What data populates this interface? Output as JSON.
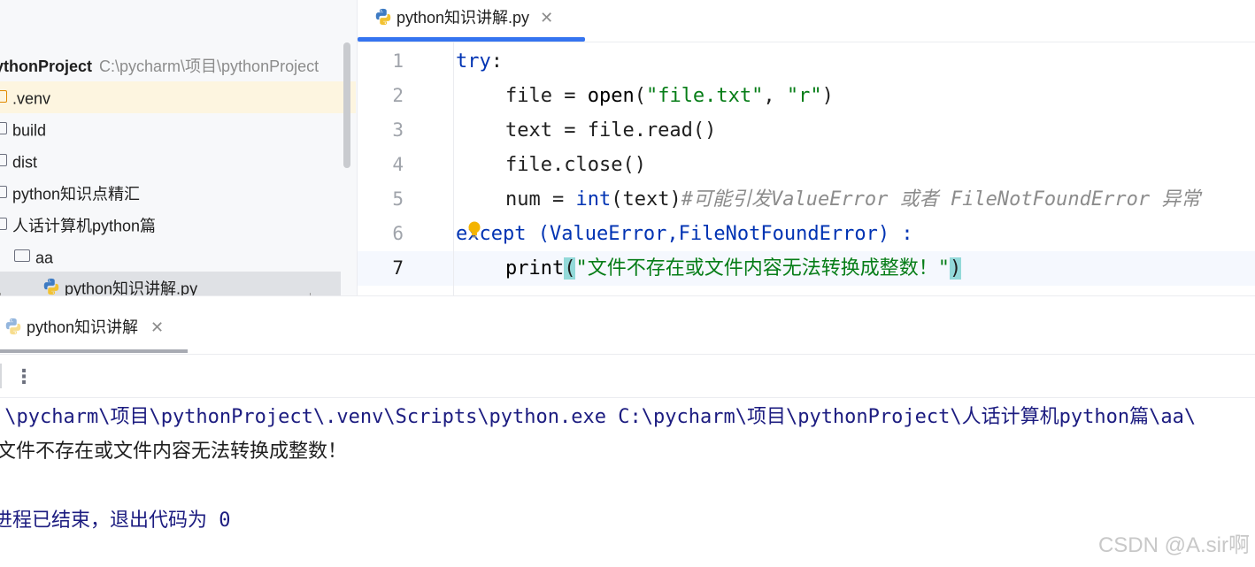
{
  "project": {
    "root_name": "ythonProject",
    "root_path": "C:\\pycharm\\项目\\pythonProject",
    "items": [
      {
        "label": ".venv",
        "icon": "folder-icon"
      },
      {
        "label": "build",
        "icon": "folder-icon"
      },
      {
        "label": "dist",
        "icon": "folder-icon"
      },
      {
        "label": "python知识点精汇",
        "icon": "folder-icon"
      },
      {
        "label": "人话计算机python篇",
        "icon": "folder-icon"
      },
      {
        "label": "aa",
        "icon": "folder-icon"
      },
      {
        "label": "python知识讲解.py",
        "icon": "python-file-icon"
      }
    ]
  },
  "editor": {
    "tab_label": "python知识讲解.py",
    "tab_close": "✕",
    "line_numbers": [
      "1",
      "2",
      "3",
      "4",
      "5",
      "6",
      "7"
    ],
    "code": {
      "l1_kw": "try",
      "l1_rest": ":",
      "l2_a": "file = ",
      "l2_fn": "open",
      "l2_b": "(",
      "l2_s1": "\"file.txt\"",
      "l2_c": ", ",
      "l2_s2": "\"r\"",
      "l2_d": ")",
      "l3": "text = file.read()",
      "l4": "file.close()",
      "l5_a": "num = ",
      "l5_fn": "int",
      "l5_b": "(text)",
      "l5_cmt": "#可能引发ValueError 或者 FileNotFoundError 异常",
      "l6_kw": "except",
      "l6_rest": " (ValueError,FileNotFoundError) :",
      "l7_fn": "print",
      "l7_open": "(",
      "l7_str": "\"文件不存在或文件内容无法转换成整数！\"",
      "l7_close": ")"
    }
  },
  "run": {
    "tab_label": "python知识讲解",
    "tab_close": "✕",
    "more_icon": "⋮",
    "command": ":\\pycharm\\项目\\pythonProject\\.venv\\Scripts\\python.exe C:\\pycharm\\项目\\pythonProject\\人话计算机python篇\\aa\\",
    "output": "文件不存在或文件内容无法转换成整数！",
    "exit_line": "进程已结束，退出代码为 0"
  },
  "watermark": "CSDN @A.sir啊",
  "colors": {
    "keyword": "#0033b3",
    "string": "#067d17",
    "comment": "#8c8c8c",
    "accent": "#3574f0"
  }
}
